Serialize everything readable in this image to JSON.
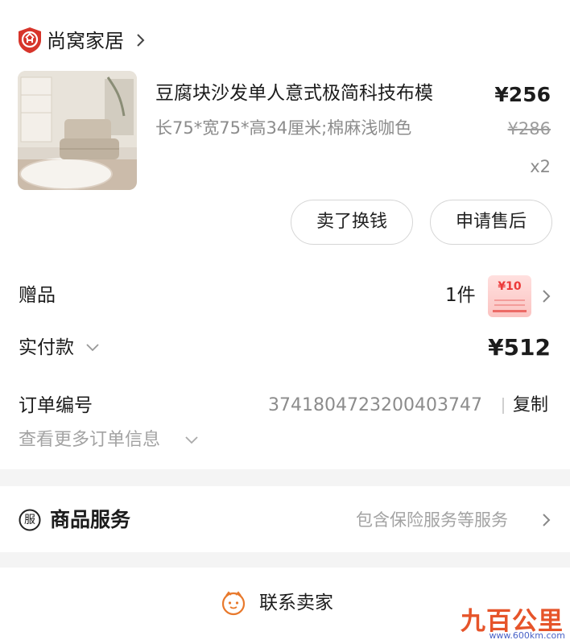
{
  "shop": {
    "name": "尚窝家居",
    "icon": "shop-badge-icon"
  },
  "product": {
    "title": "豆腐块沙发单人意式极简科技布模",
    "spec": "长75*宽75*高34厘米;棉麻浅咖色",
    "price": "¥256",
    "original_price": "¥286",
    "quantity": "x2"
  },
  "actions": {
    "sell_label": "卖了换钱",
    "after_sale_label": "申请售后"
  },
  "gift": {
    "label": "赠品",
    "count": "1件",
    "coupon_amount": "¥10"
  },
  "payment": {
    "label": "实付款",
    "amount": "¥512"
  },
  "order": {
    "label": "订单编号",
    "number": "3741804723200403747",
    "copy_label": "复制",
    "more_label": "查看更多订单信息"
  },
  "service": {
    "icon_text": "服",
    "title": "商品服务",
    "desc": "包含保险服务等服务"
  },
  "contact": {
    "label": "联系卖家"
  },
  "watermark": {
    "text": "九百公里",
    "url": "www.600km.com"
  },
  "colors": {
    "accent": "#e84a2c",
    "coupon": "#ec3a3a",
    "muted": "#8c8c8c"
  }
}
